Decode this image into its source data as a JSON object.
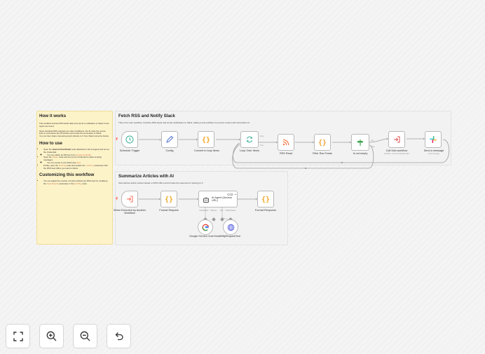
{
  "notes": {
    "how_it_works": {
      "title": "How it works",
      "p1": "This workflow fetches RSS feeds daily and sends a notification to Slack if new topics are found.",
      "p2": "Since standard RSS snippets are often insufficient, the AI visits the source links to summarize the full articles and sends the summaries to Slack.",
      "p3": "You can then share interesting topics directly to X from Slack using the button."
    },
    "how_to_use": {
      "title": "How to use",
      "b1_pre": "Open the ",
      "b1_bold": "Gemini Chat Model",
      "b1_post": " node (attached to the AI Agent) and set up the Credential.",
      "b1_sub_pre": "You can obtain an API key from ",
      "b1_sub_link": "Google AI Studio",
      "b1_sub_post": ".",
      "b2_pre": "Open the ",
      "b2_code": "Slack",
      "b2_post": " node and set up the Credential to allow sending messages.",
      "b2_sub_pre": "You can create a new Slack App ",
      "b2_sub_link": "here",
      "b2_sub_post": ".",
      "b3_pre": "Finally, open the ",
      "b3_code": "Config",
      "b3_mid": " node and update the ",
      "b3_code2": "rssUrls",
      "b3_post": " parameter with the RSS feed URLs you want to follow."
    },
    "customizing": {
      "title": "Customizing this workflow",
      "b1_pre": "You can adjust the number of topics fetched per RSS feed by modifying the ",
      "b1_code": "tweetCount",
      "b1_mid": " parameter in the ",
      "b1_code2": "Config",
      "b1_post": " node."
    }
  },
  "section_fetch": {
    "title": "Fetch RSS and Notify Slack",
    "desc": "This is the main workflow. It fetches RSS feeds and sends notifications to Slack, calling a sub-workflow to process content with Generative AI."
  },
  "section_summarize": {
    "title": "Summarize Articles with AI",
    "desc": "Summarizes article content based on RSS URLs and formats the response for posting to X."
  },
  "nodes": {
    "schedule": "Schedule Trigger",
    "config": "Config",
    "convert": "Convert to loop items",
    "loop": "Loop Over Items",
    "rss": "RSS Read",
    "filter": "Filter Rss Feeds",
    "notempty": "Is not empty",
    "callsub": "Call Sub-workflow",
    "callsub_sub": "workflow: 'rdsYnomcE9spbxgfe'",
    "slack": "Send a message",
    "slack_sub": "post:message",
    "when_exec": "When Executed by Another Workflow",
    "format_req": "Format Request",
    "agent": "AI Agent (Access URL)",
    "format_resp": "Format Response",
    "gemini": "Google Gemini Chat Model",
    "http_tool": "HttpRequestTool",
    "lbl_chat_model": "Chat Model*",
    "lbl_memory": "Memory",
    "lbl_tool": "Tool",
    "lbl_output_parser": "Output Parser",
    "lbl_done": "done",
    "lbl_loop": "loop",
    "lbl_true": "true",
    "lbl_false": "false"
  },
  "colors": {
    "accent": "#ff6d5a",
    "trigger_green": "#3fb29a",
    "code_orange": "#f2a622",
    "rss_orange": "#f26522",
    "filter_orange": "#f0a338",
    "if_green": "#41a54f",
    "callsub_red": "#e14d4d",
    "config_blue": "#4b6fcf",
    "http_blue": "#5a62e0"
  },
  "controls": {
    "fit": "fit-view-icon",
    "zoom_in": "zoom-in-icon",
    "zoom_out": "zoom-out-icon",
    "undo": "undo-icon"
  }
}
